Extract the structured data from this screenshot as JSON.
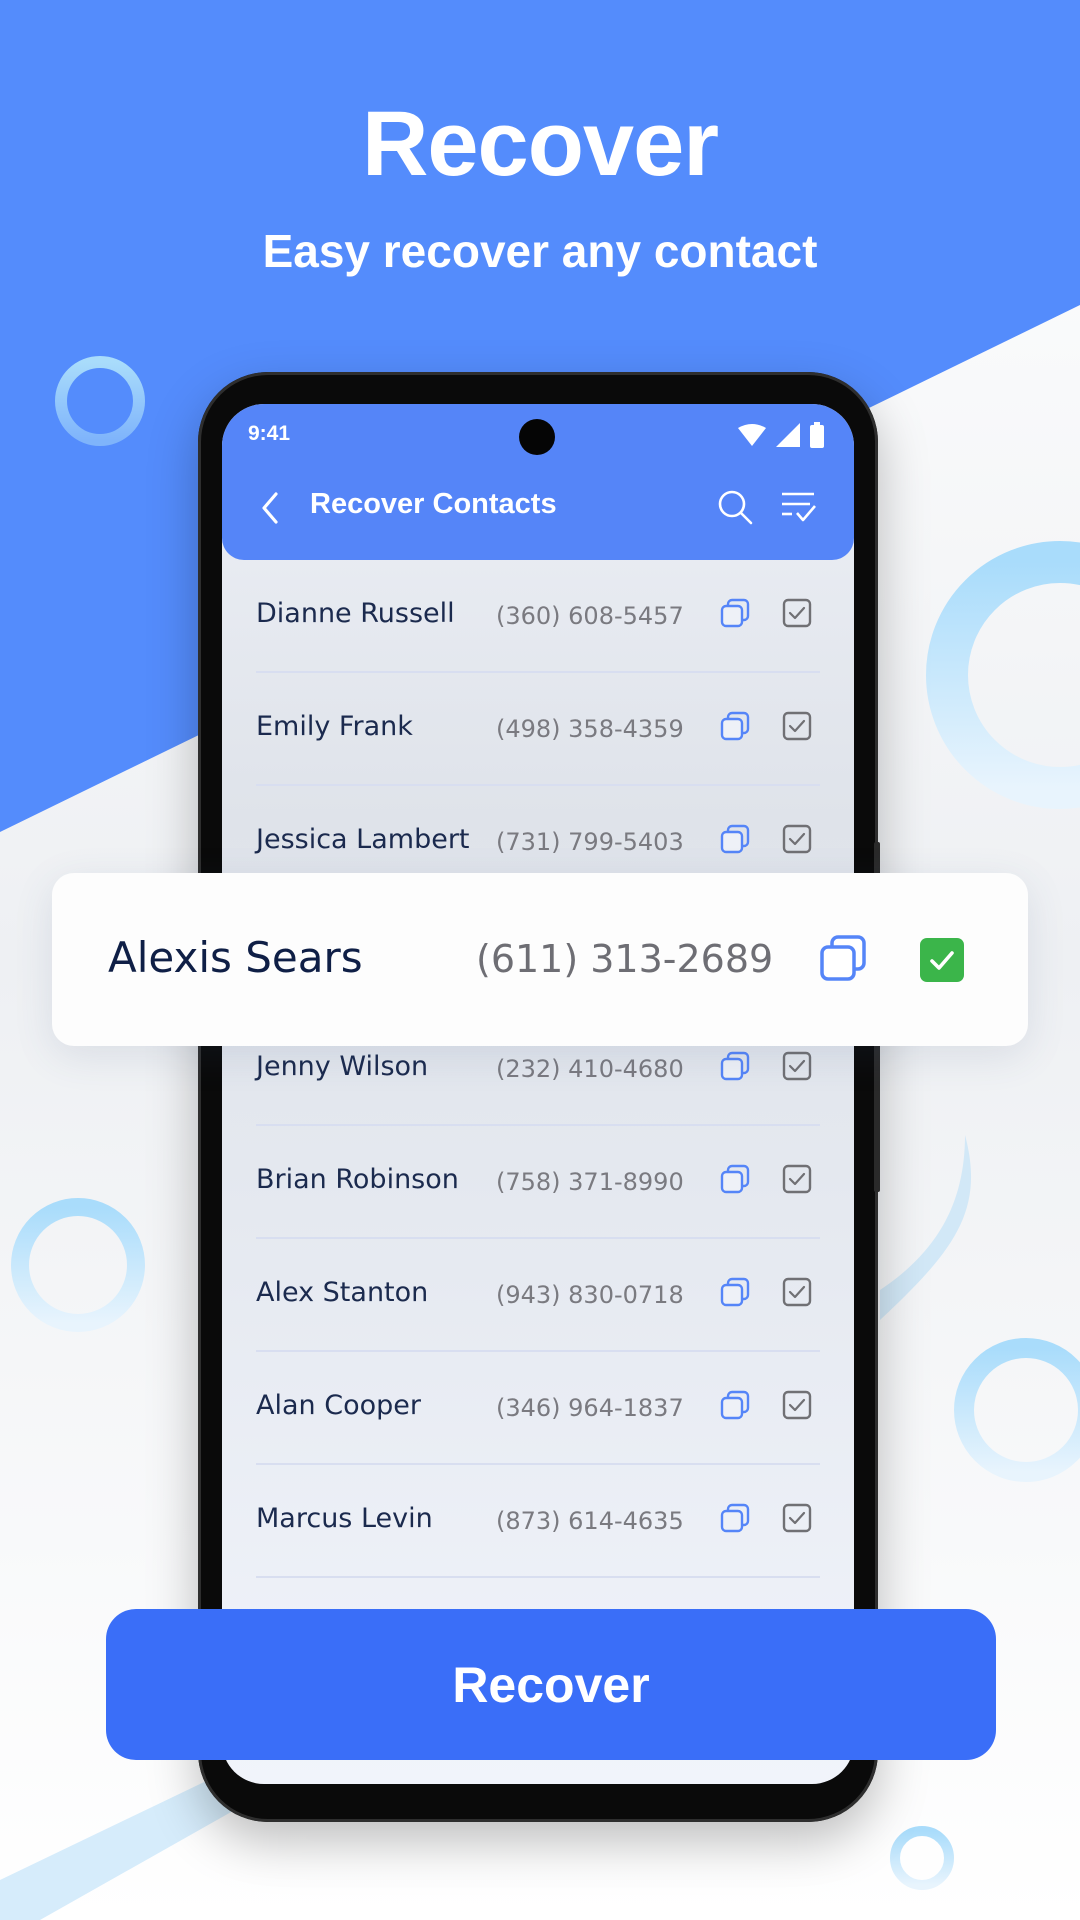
{
  "hero": {
    "title": "Recover",
    "subtitle": "Easy recover any contact"
  },
  "colors": {
    "brand_blue": "#548cfc",
    "appbar_blue": "#5585f8",
    "button_blue": "#3a6ef8",
    "check_green": "#3bb54a",
    "name_text": "#1b2a4e",
    "phone_text": "#7a7a80"
  },
  "status_bar": {
    "time": "9:41",
    "icons": [
      "wifi-icon",
      "signal-icon",
      "battery-icon"
    ]
  },
  "app_bar": {
    "back_icon": "chevron-left-icon",
    "title": "Recover Contacts",
    "search_icon": "search-icon",
    "filter_icon": "checklist-icon"
  },
  "contacts": [
    {
      "name": "Dianne Russell",
      "phone": "(360) 608-5457",
      "checked": true
    },
    {
      "name": "Emily Frank",
      "phone": "(498) 358-4359",
      "checked": true
    },
    {
      "name": "Jessica Lambert",
      "phone": "(731) 799-5403",
      "checked": true
    },
    {
      "name": "Jenny Wilson",
      "phone": "(232) 410-4680",
      "checked": true
    },
    {
      "name": "Brian Robinson",
      "phone": "(758) 371-8990",
      "checked": true
    },
    {
      "name": "Alex Stanton",
      "phone": "(943) 830-0718",
      "checked": true
    },
    {
      "name": "Alan Cooper",
      "phone": "(346) 964-1837",
      "checked": true
    },
    {
      "name": "Marcus Levin",
      "phone": "(873) 614-4635",
      "checked": true
    }
  ],
  "highlighted_contact": {
    "name": "Alexis Sears",
    "phone": "(611) 313-2689",
    "checked": true
  },
  "actions": {
    "recover_label": "Recover"
  }
}
